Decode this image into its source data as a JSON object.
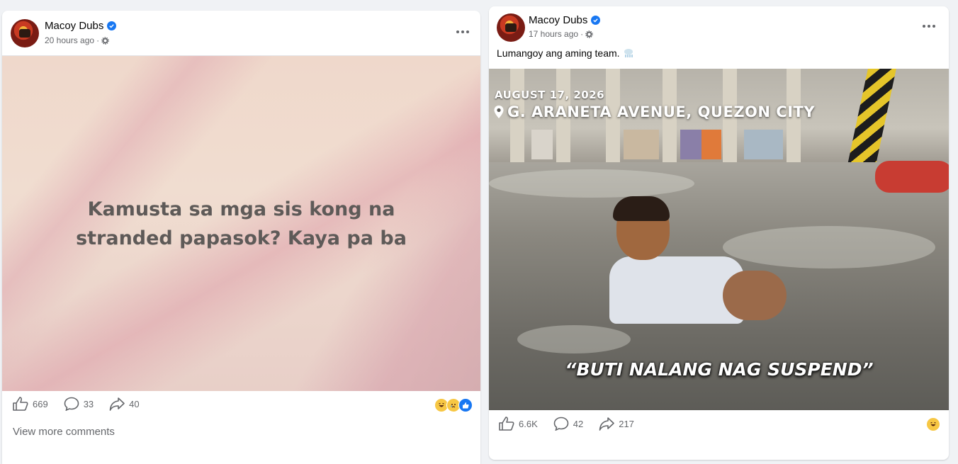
{
  "posts": [
    {
      "author": "Macoy Dubs",
      "time": "20 hours ago",
      "text_post": "Kamusta sa mga sis kong na stranded papasok? Kaya pa ba",
      "likes": "669",
      "comments": "33",
      "shares": "40",
      "view_more": "View more comments"
    },
    {
      "author": "Macoy Dubs",
      "time": "17 hours ago",
      "caption": "Lumangoy ang aming team.",
      "image_overlay": {
        "date": "AUGUST 17, 2026",
        "location": "G. ARANETA AVENUE, QUEZON CITY",
        "quote": "“BUTI NALANG NAG SUSPEND”"
      },
      "likes": "6.6K",
      "comments": "42",
      "shares": "217"
    }
  ],
  "colors": {
    "verified": "#1877f2",
    "muted_text": "#65676b",
    "page_bg": "#f0f2f5"
  },
  "icons": [
    "verified-icon",
    "gear-icon",
    "more-icon",
    "like-icon",
    "comment-icon",
    "share-icon",
    "haha-reaction-icon",
    "sad-reaction-icon",
    "like-reaction-icon",
    "wind-emoji-icon",
    "location-pin-icon"
  ]
}
